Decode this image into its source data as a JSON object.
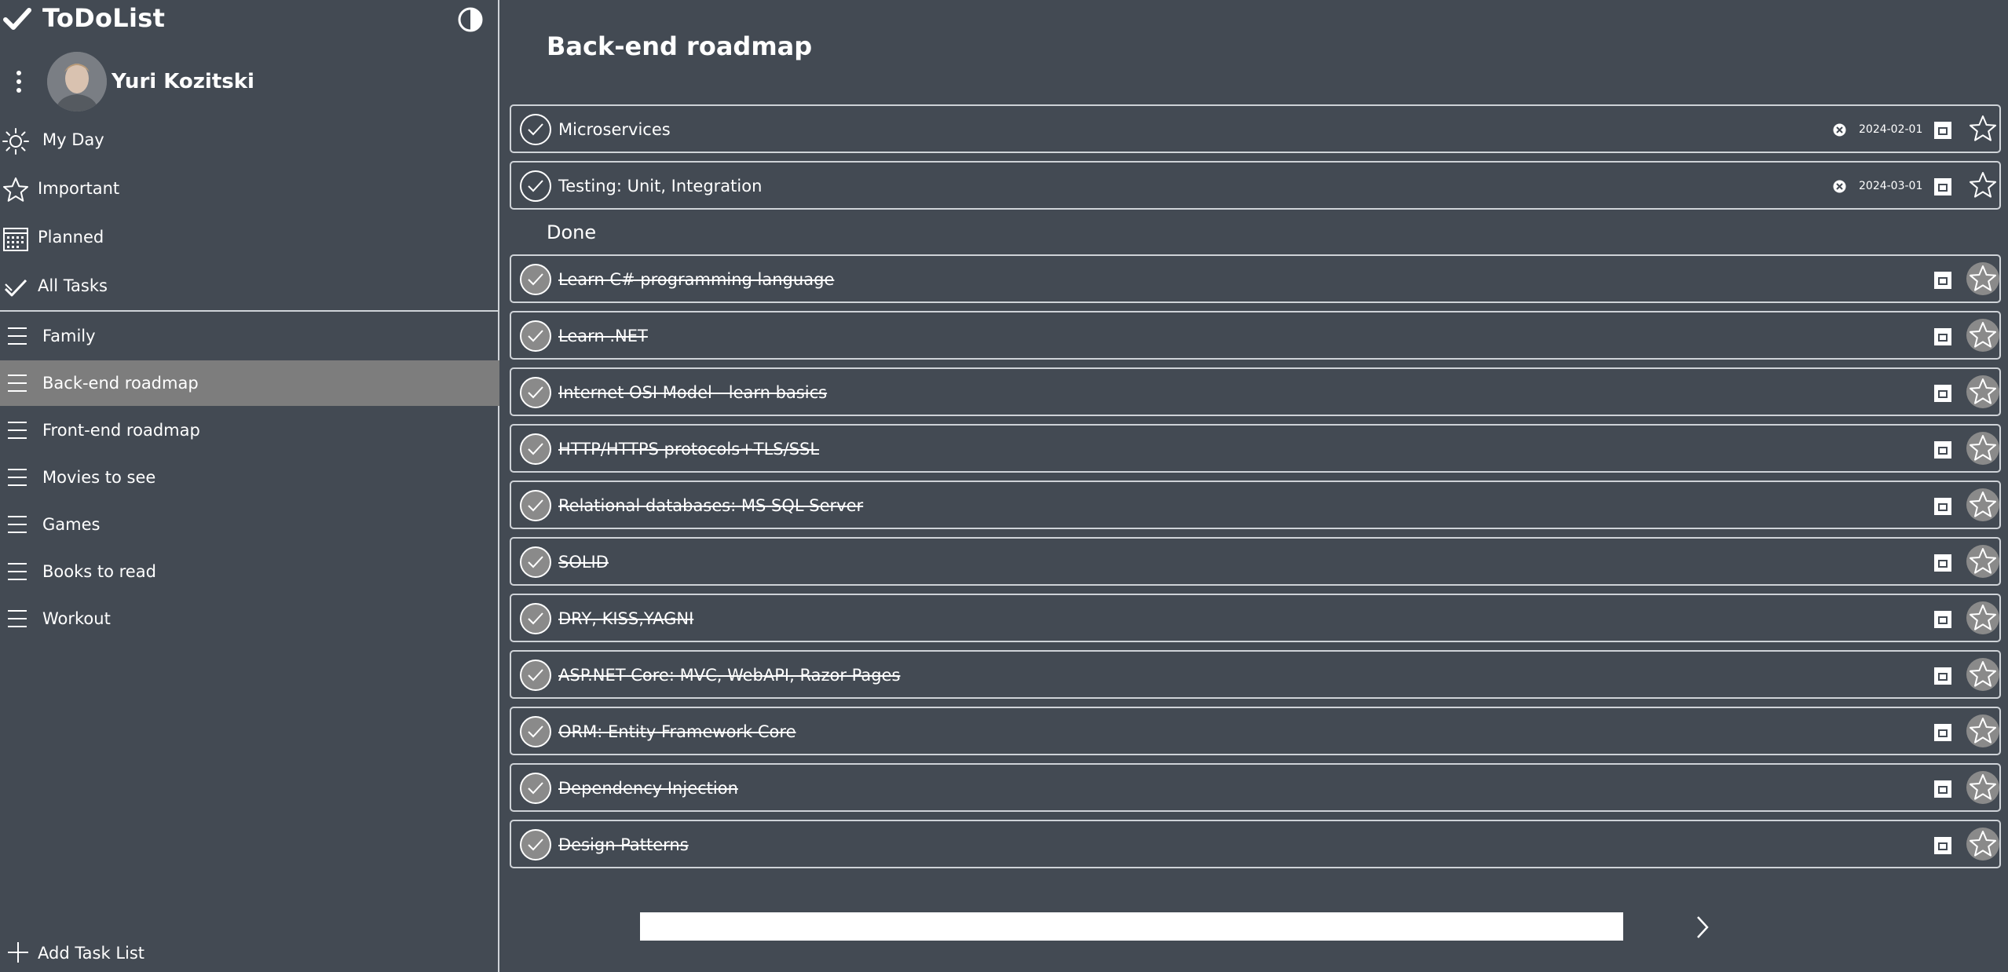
{
  "app": {
    "title": "ToDoList"
  },
  "user": {
    "name": "Yuri Kozitski"
  },
  "nav": [
    {
      "label": "My Day",
      "icon": "sun-icon"
    },
    {
      "label": "Important",
      "icon": "star-icon"
    },
    {
      "label": "Planned",
      "icon": "calendar-icon"
    },
    {
      "label": "All Tasks",
      "icon": "check-icon"
    }
  ],
  "lists": [
    {
      "label": "Family",
      "active": false
    },
    {
      "label": "Back-end roadmap",
      "active": true
    },
    {
      "label": "Front-end roadmap",
      "active": false
    },
    {
      "label": "Movies to see",
      "active": false
    },
    {
      "label": "Games",
      "active": false
    },
    {
      "label": "Books to read",
      "active": false
    },
    {
      "label": "Workout",
      "active": false
    }
  ],
  "add_list_label": "Add Task List",
  "main": {
    "title": "Back-end roadmap",
    "done_heading": "Done",
    "new_task_placeholder": ""
  },
  "open_tasks": [
    {
      "text": "Microservices",
      "due": "2024-02-01"
    },
    {
      "text": "Testing: Unit, Integration",
      "due": "2024-03-01"
    }
  ],
  "done_tasks": [
    {
      "text": "Learn C# programming language"
    },
    {
      "text": "Learn .NET"
    },
    {
      "text": "Internet OSI Model - learn basics"
    },
    {
      "text": "HTTP/HTTPS protocols+TLS/SSL"
    },
    {
      "text": "Relational databases: MS SQL Server"
    },
    {
      "text": "SOLID"
    },
    {
      "text": "DRY, KISS,YAGNI"
    },
    {
      "text": "ASP.NET Core: MVC, WebAPI, Razor Pages"
    },
    {
      "text": "ORM: Entity Framework Core"
    },
    {
      "text": "Dependency Injection"
    },
    {
      "text": "Design Patterns"
    }
  ],
  "colors": {
    "background": "#434a53",
    "border": "#cfd3d8",
    "active_list": "#7d7d7d",
    "done_fill": "#8a8a8a"
  }
}
